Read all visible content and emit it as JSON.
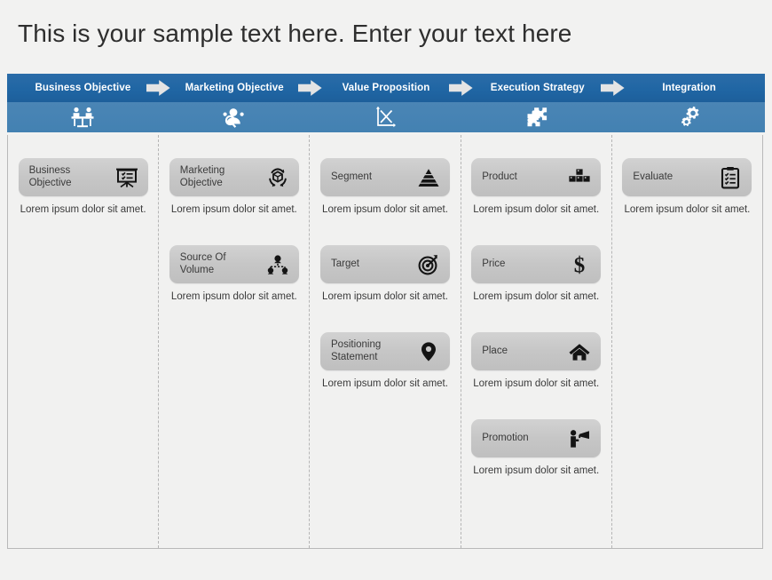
{
  "title": "This is your sample text here. Enter your text here",
  "colors": {
    "header_top": "#2066a4",
    "header_bottom": "#4a85b5",
    "arrow": "#e4e4e4",
    "pill": "#c8c8c8",
    "page_bg": "#f2f2f1",
    "text": "#3a3a3a"
  },
  "header": {
    "stages": [
      {
        "label": "Business Objective",
        "icon": "meeting-table-icon",
        "arrow": true
      },
      {
        "label": "Marketing Objective",
        "icon": "person-search-icon",
        "arrow": true
      },
      {
        "label": "Value Proposition",
        "icon": "line-chart-icon",
        "arrow": true
      },
      {
        "label": "Execution Strategy",
        "icon": "puzzle-pieces-icon",
        "arrow": true
      },
      {
        "label": "Integration",
        "icon": "gears-icon",
        "arrow": false
      }
    ]
  },
  "body": {
    "columns": [
      {
        "name": "business-objective",
        "cards": [
          {
            "label": "Business Objective",
            "icon": "presentation-board-icon",
            "desc": "Lorem ipsum dolor sit amet."
          }
        ]
      },
      {
        "name": "marketing-objective",
        "cards": [
          {
            "label": "Marketing Objective",
            "icon": "cube-recycle-icon",
            "desc": "Lorem ipsum dolor sit amet."
          },
          {
            "label": "Source Of Volume",
            "icon": "org-chart-icon",
            "desc": "Lorem ipsum dolor sit amet."
          }
        ]
      },
      {
        "name": "value-proposition",
        "cards": [
          {
            "label": "Segment",
            "icon": "pyramid-icon",
            "desc": "Lorem ipsum dolor sit amet."
          },
          {
            "label": "Target",
            "icon": "target-arrow-icon",
            "desc": "Lorem ipsum dolor sit amet."
          },
          {
            "label": "Positioning Statement",
            "icon": "location-pin-icon",
            "desc": "Lorem ipsum dolor sit amet."
          }
        ]
      },
      {
        "name": "execution-strategy",
        "cards": [
          {
            "label": "Product",
            "icon": "stacked-boxes-icon",
            "desc": "Lorem ipsum dolor sit amet."
          },
          {
            "label": "Price",
            "icon": "dollar-sign-icon",
            "desc": "Lorem ipsum dolor sit amet."
          },
          {
            "label": "Place",
            "icon": "house-icon",
            "desc": "Lorem ipsum dolor sit amet."
          },
          {
            "label": "Promotion",
            "icon": "megaphone-person-icon",
            "desc": "Lorem ipsum dolor sit amet."
          }
        ]
      },
      {
        "name": "integration",
        "cards": [
          {
            "label": "Evaluate",
            "icon": "clipboard-checklist-icon",
            "desc": "Lorem ipsum dolor sit amet."
          }
        ]
      }
    ]
  }
}
